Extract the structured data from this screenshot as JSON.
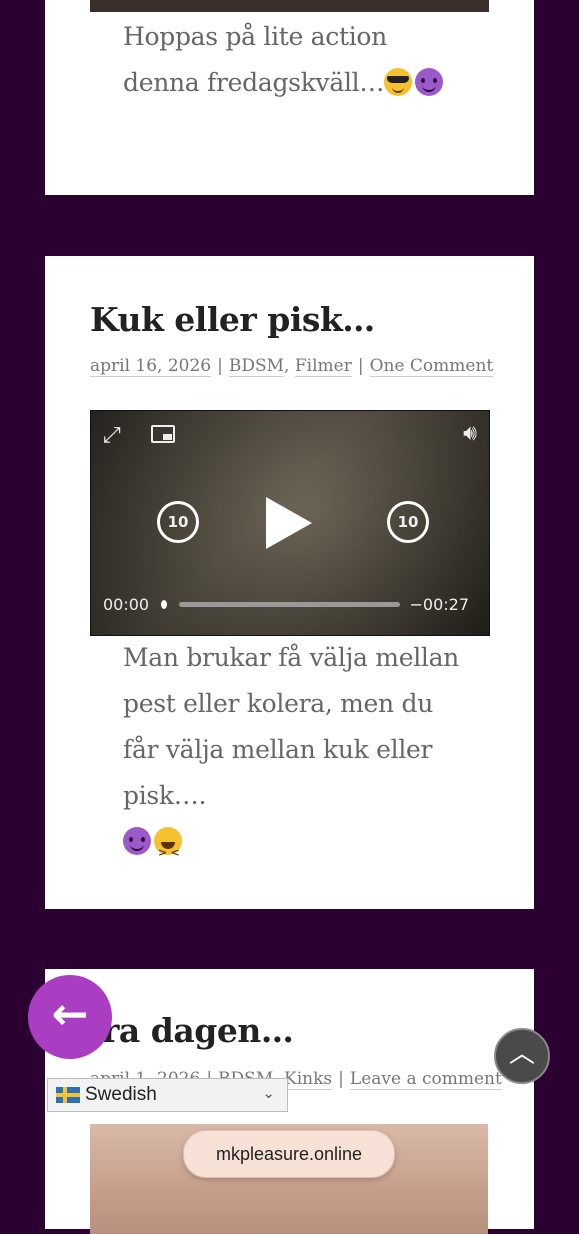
{
  "posts": [
    {
      "text": "Hoppas på lite action denna fredagskväll…",
      "emojis": [
        "smiling-face-with-sunglasses",
        "smiling-face-with-horns"
      ]
    },
    {
      "title": "Kuk eller pisk…",
      "date": "april 16, 2026",
      "categories": [
        "BDSM",
        "Filmer"
      ],
      "comments": "One Comment",
      "video": {
        "current_time": "00:00",
        "remaining_time": "−00:27",
        "skip_back": "10",
        "skip_forward": "10",
        "progress": 0
      },
      "text": "Man brukar få välja mellan pest eller kolera, men du får välja mellan kuk eller pisk….",
      "emojis": [
        "smiling-face-with-horns",
        "grinning-squinting-face"
      ]
    },
    {
      "title_visible": "ira dagen…",
      "date_partial": "april 1, 2026",
      "categories": [
        "BDSM",
        "Kinks"
      ],
      "comments": "Leave a comment"
    }
  ],
  "language_selector": {
    "selected": "Swedish"
  },
  "url": "mkpleasure.online",
  "colors": {
    "background": "#2a0130",
    "fab": "#a93ec3"
  }
}
